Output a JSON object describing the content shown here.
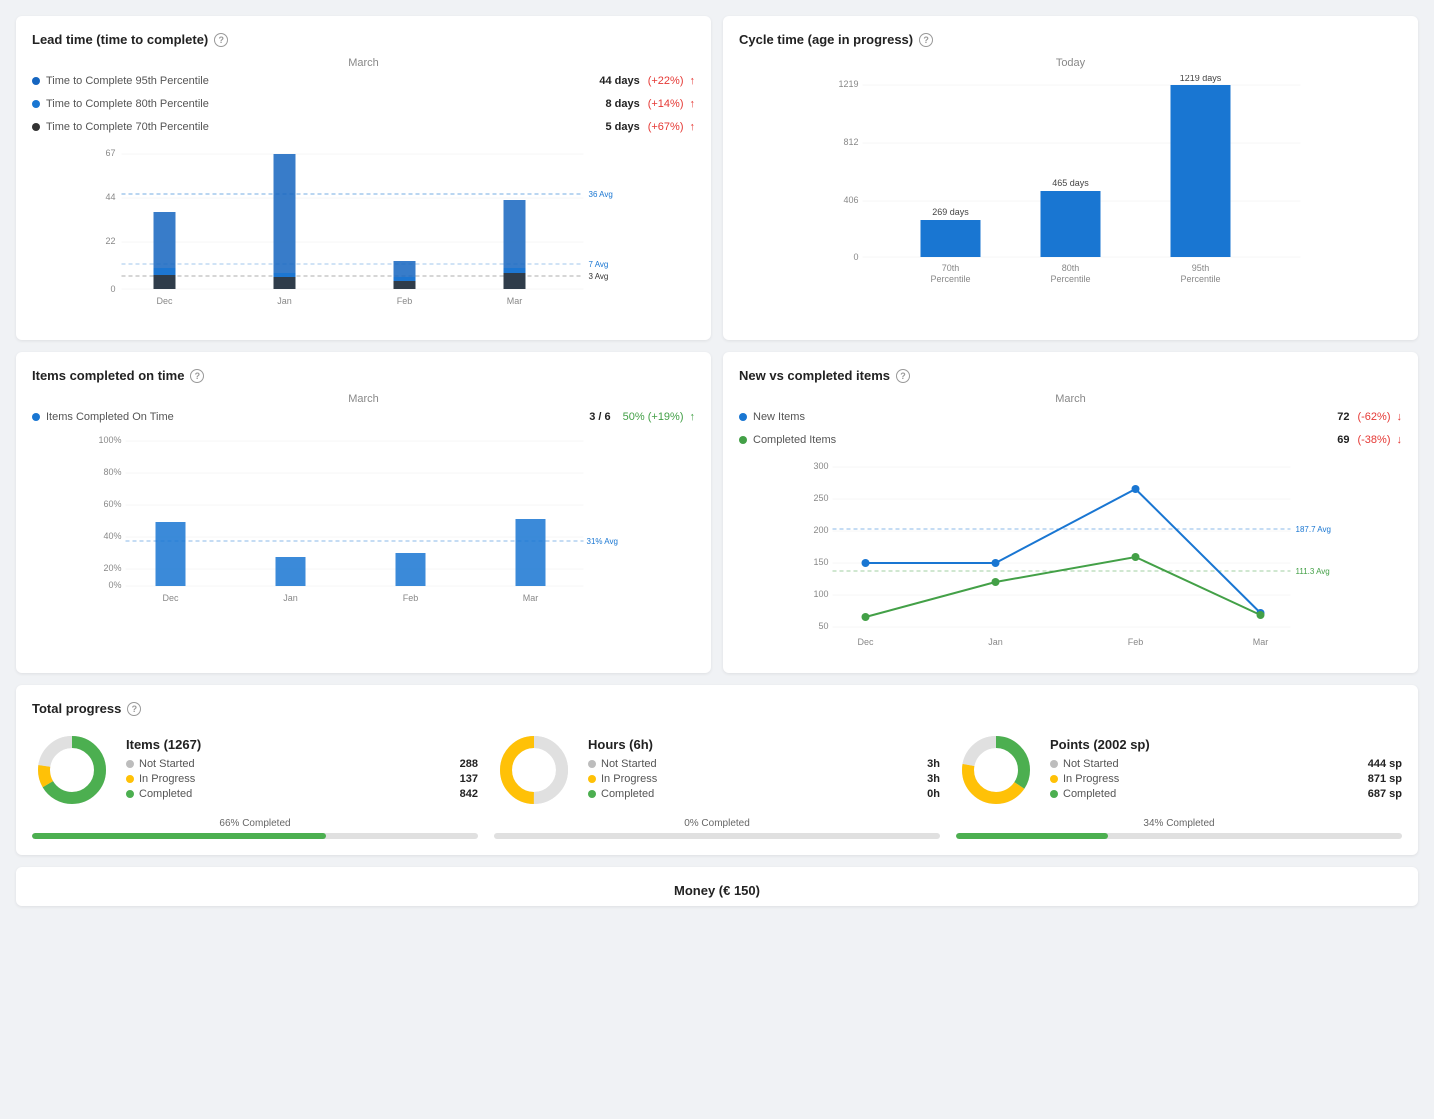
{
  "leadTime": {
    "title": "Lead time (time to complete)",
    "period": "March",
    "legends": [
      {
        "label": "Time to Complete 95th Percentile",
        "color": "#1565C0",
        "value": "44 days",
        "change": "(+22%)",
        "trend": "up",
        "changeColor": "red"
      },
      {
        "label": "Time to Complete 80th Percentile",
        "color": "#1976D2",
        "value": "8 days",
        "change": "(+14%)",
        "trend": "up",
        "changeColor": "red"
      },
      {
        "label": "Time to Complete 70th Percentile",
        "color": "#333333",
        "value": "5 days",
        "change": "(+67%)",
        "trend": "up",
        "changeColor": "red"
      }
    ],
    "avgLabels": [
      "36 Avg",
      "7 Avg",
      "3 Avg"
    ],
    "yLabels": [
      "67",
      "44",
      "22",
      "0"
    ],
    "xLabels": [
      "Dec",
      "Jan",
      "Feb",
      "Mar"
    ],
    "bars": {
      "Dec": {
        "p95": 38,
        "p80": 10,
        "p70": 7
      },
      "Jan": {
        "p95": 67,
        "p80": 8,
        "p70": 6
      },
      "Feb": {
        "p95": 14,
        "p80": 6,
        "p70": 4
      },
      "Mar": {
        "p95": 44,
        "p80": 10,
        "p70": 8
      }
    }
  },
  "cycleTime": {
    "title": "Cycle time (age in progress)",
    "period": "Today",
    "yLabels": [
      "1219",
      "812",
      "406",
      "0"
    ],
    "xLabels": [
      "70th\nPercentile",
      "80th\nPercentile",
      "95th\nPercentile"
    ],
    "bars": [
      {
        "label": "70th\nPercentile",
        "value": 269,
        "days": "269 days"
      },
      {
        "label": "80th\nPercentile",
        "value": 465,
        "days": "465 days"
      },
      {
        "label": "95th\nPercentile",
        "value": 1219,
        "days": "1219 days"
      }
    ]
  },
  "itemsOnTime": {
    "title": "Items completed on time",
    "period": "March",
    "legends": [
      {
        "label": "Items Completed On Time",
        "color": "#1976D2",
        "value": "3 / 6",
        "change": "50% (+19%)",
        "trend": "up",
        "changeColor": "green"
      }
    ],
    "avgLabel": "31% Avg",
    "yLabels": [
      "100%",
      "80%",
      "60%",
      "40%",
      "20%",
      "0%"
    ],
    "xLabels": [
      "Dec",
      "Jan",
      "Feb",
      "Mar"
    ],
    "bars": {
      "Dec": 44,
      "Jan": 20,
      "Feb": 23,
      "Mar": 46
    }
  },
  "newVsCompleted": {
    "title": "New vs completed items",
    "period": "March",
    "legends": [
      {
        "label": "New Items",
        "color": "#1976D2",
        "value": "72",
        "change": "(-62%)",
        "trend": "down",
        "changeColor": "red"
      },
      {
        "label": "Completed Items",
        "color": "#43a047",
        "value": "69",
        "change": "(-38%)",
        "trend": "down",
        "changeColor": "red"
      }
    ],
    "avgLabels": [
      "187.7 Avg",
      "111.3 Avg"
    ],
    "yLabels": [
      "300",
      "250",
      "200",
      "150",
      "100",
      "50"
    ],
    "xLabels": [
      "Dec",
      "Jan",
      "Feb",
      "Mar"
    ],
    "newPoints": [
      150,
      150,
      265,
      72
    ],
    "completedPoints": [
      65,
      120,
      160,
      68
    ]
  },
  "totalProgress": {
    "title": "Total progress",
    "items": {
      "title": "Items (1267)",
      "notStarted": {
        "label": "Not Started",
        "value": "288",
        "color": "#bdbdbd"
      },
      "inProgress": {
        "label": "In Progress",
        "value": "137",
        "color": "#FFC107"
      },
      "completed": {
        "label": "Completed",
        "value": "842",
        "color": "#4CAF50"
      },
      "percentLabel": "66% Completed",
      "percent": 66,
      "donut": {
        "notStarted": 22.7,
        "inProgress": 10.8,
        "completed": 66.5
      }
    },
    "hours": {
      "title": "Hours (6h)",
      "notStarted": {
        "label": "Not Started",
        "value": "3h",
        "color": "#bdbdbd"
      },
      "inProgress": {
        "label": "In Progress",
        "value": "3h",
        "color": "#FFC107"
      },
      "completed": {
        "label": "Completed",
        "value": "0h",
        "color": "#4CAF50"
      },
      "percentLabel": "0% Completed",
      "percent": 0,
      "donut": {
        "notStarted": 50,
        "inProgress": 50,
        "completed": 0
      }
    },
    "points": {
      "title": "Points (2002 sp)",
      "notStarted": {
        "label": "Not Started",
        "value": "444 sp",
        "color": "#bdbdbd"
      },
      "inProgress": {
        "label": "In Progress",
        "value": "871 sp",
        "color": "#FFC107"
      },
      "completed": {
        "label": "Completed",
        "value": "687 sp",
        "color": "#4CAF50"
      },
      "percentLabel": "34% Completed",
      "percent": 34,
      "donut": {
        "notStarted": 22.2,
        "inProgress": 43.5,
        "completed": 34.3
      }
    }
  },
  "money": {
    "title": "Money (€ 150)"
  }
}
